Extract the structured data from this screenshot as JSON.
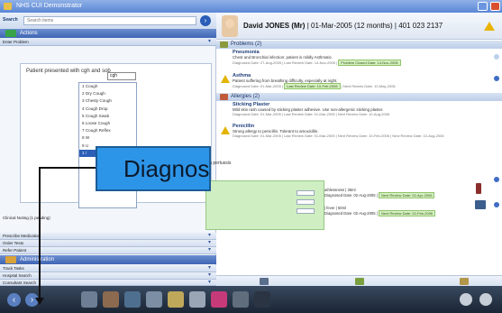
{
  "window": {
    "title": "NHS CUI Demonstrator"
  },
  "search": {
    "label": "Search",
    "placeholder": "Search items"
  },
  "actions": {
    "title": "Actions",
    "enter_problem": "Enter Problem"
  },
  "problem_entry": {
    "text": "Patient presented with",
    "typed": "cgh and sob",
    "query": "cgh",
    "suggestions": [
      "1 Cough",
      "2 Dry Cough",
      "3 Chesty Cough",
      "4 Cough Drop",
      "5 Cough Swab",
      "6 Loose Cough",
      "7 Cough Reflex",
      "8 W",
      "9 U",
      "1 /"
    ],
    "selected_index": 9
  },
  "clinical_noting": "Clinical Noting (1 pending)",
  "nav": [
    "Prescribe Medication",
    "Order Tests",
    "Refer Patient"
  ],
  "administration": {
    "title": "Administration",
    "items": [
      "Track Tasks",
      "Hospital Search",
      "Consultant Search"
    ]
  },
  "patient": {
    "name": "David JONES (Mr)",
    "details": "| 01-Mar-2005 (12 months) | 401 023 2137"
  },
  "problems": {
    "header": "Problems (2)",
    "items": [
      {
        "name": "Pneumonia",
        "desc": "Chest and Bronchial infection: patient is mildly Asthmatic.",
        "dates": "Diagnosed Date: 27-Aug-2005 | Last Review Date: 14-Nov-2005 |",
        "tag": "Problem Closed Date: 14-Nov-2005"
      },
      {
        "name": "Asthma",
        "desc": "Patient suffering from breathing difficulty, especially at night.",
        "dates": "Diagnosed Date: 01-Mar-2005 |",
        "tag": "Last Review Date: 10-Feb-2006",
        "extra": "| Next Review Date: 10-May-2006"
      }
    ]
  },
  "allergies": {
    "header": "Allergies (2)",
    "items": [
      {
        "name": "Sticking Plaster",
        "desc": "Mild skin rash caused by sticking plaster adhesive. Use non-allergenic sticking plaster.",
        "dates": "Diagnosed Date: 01-Mar-2005 | Last Review Date: 01-Mar-2005 | Next Review Date: 10-Aug-2006"
      },
      {
        "name": "Penicillin",
        "desc": "Strong allergy to penicillin. Tolerant to amoxicillin.",
        "dates": "Diagnosed Date: 01-Mar-2005 | Last Review Date: 01-Mar-2005 | Next Review Date: 10-Feb-2006 | Next Review Date: 10-Aug-2006"
      }
    ]
  },
  "popup": {
    "title": "lla pertussis"
  },
  "medications": [
    {
      "text": "athlessness | 35ml",
      "dates": "Diagnosed Date: 02-Aug-2005 |",
      "tag": "Next Review Date: 02-Apr-2006"
    },
    {
      "text": "| fever | 50ml",
      "dates": "Diagnosed Date: 02-Aug-2005 |",
      "tag": "Next Review Date: 02-Feb-2006"
    }
  ],
  "callout": {
    "text": "Diagnos"
  }
}
